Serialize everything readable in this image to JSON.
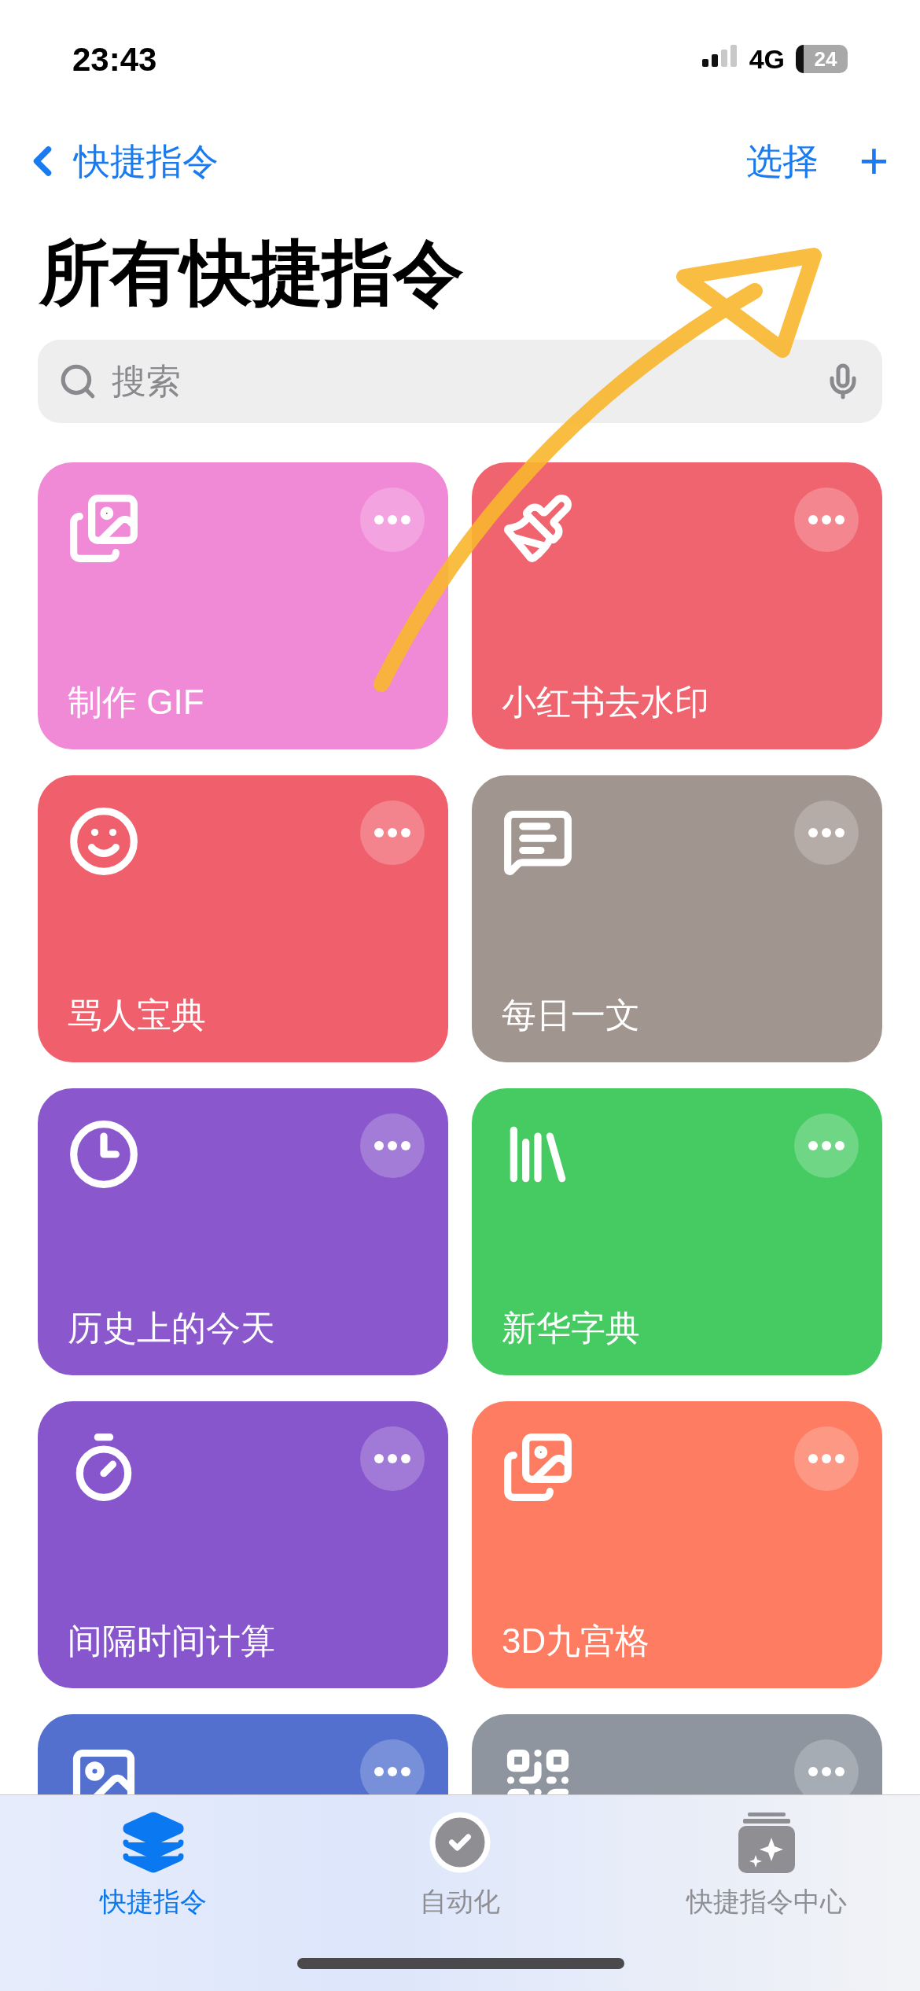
{
  "status_bar": {
    "time": "23:43",
    "network": "4G",
    "battery": "24"
  },
  "nav": {
    "back": "快捷指令",
    "select": "选择",
    "add": "+"
  },
  "title": "所有快捷指令",
  "search": {
    "placeholder": "搜索"
  },
  "shortcuts": [
    {
      "title": "制作 GIF",
      "color": "#f08ad6"
    },
    {
      "title": "小红书去水印",
      "color": "#f0646f"
    },
    {
      "title": "骂人宝典",
      "color": "#f0606c"
    },
    {
      "title": "每日一文",
      "color": "#a0958f"
    },
    {
      "title": "历史上的今天",
      "color": "#8a58cc"
    },
    {
      "title": "新华字典",
      "color": "#46cb62"
    },
    {
      "title": "间隔时间计算",
      "color": "#8755cc"
    },
    {
      "title": "3D九宫格",
      "color": "#fd7c62"
    },
    {
      "color": "#5370cf"
    },
    {
      "color": "#8e959f"
    }
  ],
  "annotation": {
    "kind": "arrow"
  },
  "tabs": [
    {
      "label": "快捷指令",
      "selected": true
    },
    {
      "label": "自动化",
      "selected": false
    },
    {
      "label": "快捷指令中心",
      "selected": false
    }
  ]
}
